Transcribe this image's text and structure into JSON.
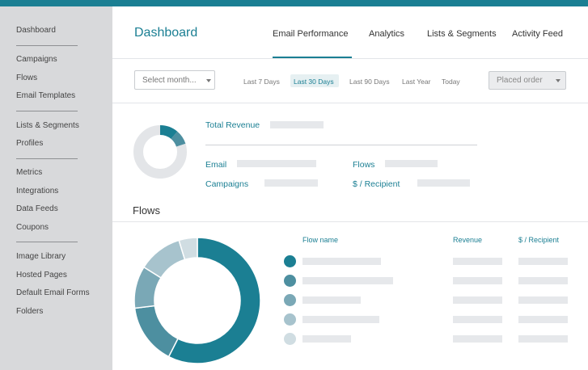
{
  "sidebar": {
    "items": [
      {
        "label": "Dashboard",
        "name": "sidebar-item-dashboard"
      },
      {
        "label": "Campaigns",
        "name": "sidebar-item-campaigns"
      },
      {
        "label": "Flows",
        "name": "sidebar-item-flows"
      },
      {
        "label": "Email Templates",
        "name": "sidebar-item-email-templates"
      },
      {
        "label": "Lists & Segments",
        "name": "sidebar-item-lists-segments"
      },
      {
        "label": "Profiles",
        "name": "sidebar-item-profiles"
      },
      {
        "label": "Metrics",
        "name": "sidebar-item-metrics"
      },
      {
        "label": "Integrations",
        "name": "sidebar-item-integrations"
      },
      {
        "label": "Data Feeds",
        "name": "sidebar-item-data-feeds"
      },
      {
        "label": "Coupons",
        "name": "sidebar-item-coupons"
      },
      {
        "label": "Image Library",
        "name": "sidebar-item-image-library"
      },
      {
        "label": "Hosted Pages",
        "name": "sidebar-item-hosted-pages"
      },
      {
        "label": "Default Email Forms",
        "name": "sidebar-item-default-email-forms"
      },
      {
        "label": "Folders",
        "name": "sidebar-item-folders"
      }
    ]
  },
  "header": {
    "title": "Dashboard",
    "tabs": [
      {
        "label": "Email Performance",
        "active": true
      },
      {
        "label": "Analytics",
        "active": false
      },
      {
        "label": "Lists & Segments",
        "active": false
      },
      {
        "label": "Activity Feed",
        "active": false
      }
    ]
  },
  "filters": {
    "month_select": "Select month...",
    "ranges": [
      "Last 7 Days",
      "Last 30 Days",
      "Last 90 Days",
      "Last Year",
      "Today"
    ],
    "active_range": "Last 30 Days",
    "metric_select": "Placed order"
  },
  "summary": {
    "total_revenue_label": "Total Revenue",
    "email_label": "Email",
    "flows_label": "Flows",
    "campaigns_label": "Campaigns",
    "per_recipient_label": "$ / Recipient"
  },
  "flows": {
    "title": "Flows",
    "columns": [
      "Flow name",
      "Revenue",
      "$ / Recipient"
    ]
  },
  "colors": {
    "accent": "#1b7f93",
    "series": [
      "#1b7f93",
      "#4d8fa0",
      "#7aa8b6",
      "#a7c3cd",
      "#d0dde2"
    ],
    "placeholder": "#e6e8eb"
  }
}
